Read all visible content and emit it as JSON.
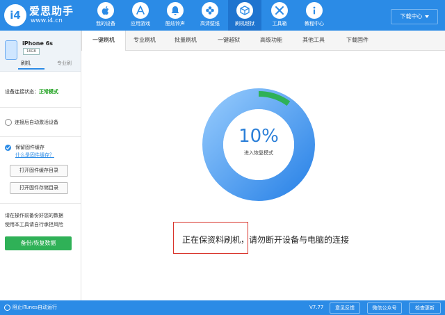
{
  "colors": {
    "accent": "#2b8be6",
    "success": "#2fb157",
    "highlight": "#d9342b"
  },
  "brand": {
    "name": "爱思助手",
    "url": "www.i4.cn",
    "logo_text": "i4"
  },
  "nav": [
    {
      "label": "我的设备",
      "icon": "apple-icon"
    },
    {
      "label": "应用游戏",
      "icon": "app-store-icon"
    },
    {
      "label": "酷炫铃声",
      "icon": "bell-icon"
    },
    {
      "label": "高清壁纸",
      "icon": "flower-icon"
    },
    {
      "label": "刷机越狱",
      "icon": "box-icon",
      "active": true
    },
    {
      "label": "工具箱",
      "icon": "tools-icon"
    },
    {
      "label": "教程中心",
      "icon": "info-icon"
    }
  ],
  "download_center": "下载中心",
  "device": {
    "name": "iPhone 6s",
    "storage": "16GB",
    "tabs": [
      "刷机",
      "专业刷"
    ]
  },
  "sidebar": {
    "status_label": "设备连接状态：",
    "status_value": "正常模式",
    "auto_activate": "连接后自动激活设备",
    "keep_cache": "保留固件缓存",
    "what_is_cache": "什么是固件缓存？",
    "open_cache_dir": "打开固件缓存目录",
    "open_store_dir": "打开固件存储目录",
    "warning": [
      "请在操作前备份好您的数据",
      "使用本工具请自行承担风险"
    ],
    "backup_button": "备份/恢复数据"
  },
  "tabs": [
    "一键刷机",
    "专业刷机",
    "批量刷机",
    "一键越狱",
    "高级功能",
    "其他工具",
    "下载固件"
  ],
  "progress": {
    "percent_text": "10%",
    "value": 10,
    "status": "进入恢复模式"
  },
  "message": "正在保资料刷机，请勿断开设备与电脑的连接",
  "bottom": {
    "itunes": "阻止iTunes自动运行",
    "version": "V7.77",
    "buttons": [
      "意见反馈",
      "微信公众号",
      "检查更新"
    ]
  }
}
